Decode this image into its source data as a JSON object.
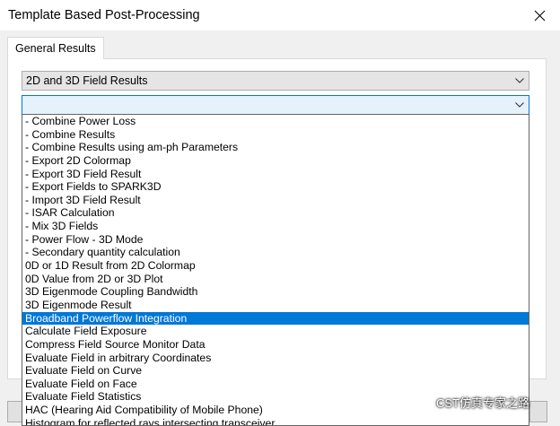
{
  "window": {
    "title": "Template Based Post-Processing"
  },
  "tabs": [
    {
      "label": "General Results"
    }
  ],
  "category_combo": {
    "selected": "2D and 3D Field Results"
  },
  "template_combo": {
    "selected": ""
  },
  "template_list": {
    "selected_index": 15,
    "items": [
      "- Combine Power Loss",
      "- Combine Results",
      "- Combine Results using am-ph Parameters",
      "- Export 2D Colormap",
      "- Export 3D Field Result",
      "- Export Fields to SPARK3D",
      "- Import 3D Field Result",
      "- ISAR Calculation",
      "- Mix 3D Fields",
      "- Power Flow - 3D Mode",
      "- Secondary quantity calculation",
      "0D or 1D Result from 2D Colormap",
      "0D Value from 2D or 3D Plot",
      "3D Eigenmode Coupling Bandwidth",
      "3D Eigenmode Result",
      "Broadband Powerflow Integration",
      "Calculate Field Exposure",
      "Compress Field Source Monitor Data",
      "Evaluate Field in arbitrary Coordinates",
      "Evaluate Field on Curve",
      "Evaluate Field on Face",
      "Evaluate Field Statistics",
      "HAC (Hearing Aid Compatibility of Mobile Phone)",
      "Histogram for reflected rays intersecting transceiver"
    ]
  },
  "watermark": {
    "text": "CST仿真专家之路"
  },
  "colors": {
    "selection": "#0078d7",
    "focus_border": "#0078d7"
  }
}
